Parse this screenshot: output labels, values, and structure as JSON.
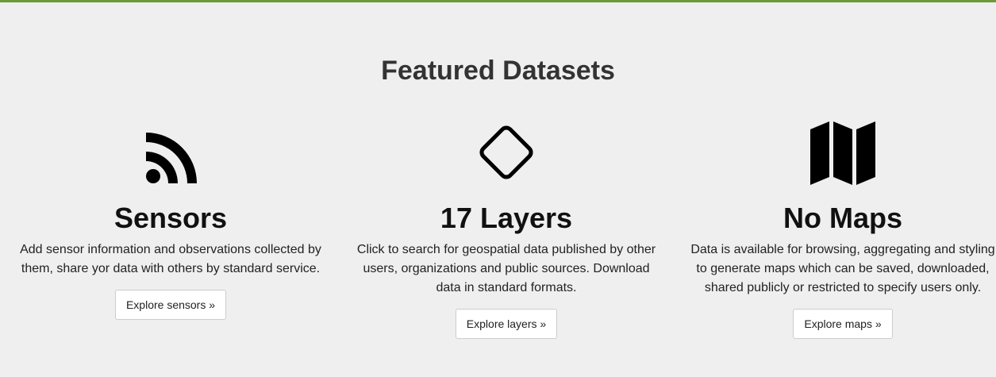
{
  "featured": {
    "title": "Featured Datasets"
  },
  "columns": [
    {
      "icon": "rss-icon",
      "title": "Sensors",
      "text": "Add sensor information and observations collected by them, share yor data with others by standard service.",
      "button": "Explore sensors »"
    },
    {
      "icon": "diamond-icon",
      "title": "17 Layers",
      "text": "Click to search for geospatial data published by other users, organizations and public sources. Download data in standard formats.",
      "button": "Explore layers »"
    },
    {
      "icon": "map-icon",
      "title": "No Maps",
      "text": "Data is available for browsing, aggregating and styling to generate maps which can be saved, downloaded, shared publicly or restricted to specify users only.",
      "button": "Explore maps »"
    }
  ],
  "colors": {
    "top_border": "#6b9b37",
    "background": "#efefef",
    "button_background": "#ffffff"
  }
}
